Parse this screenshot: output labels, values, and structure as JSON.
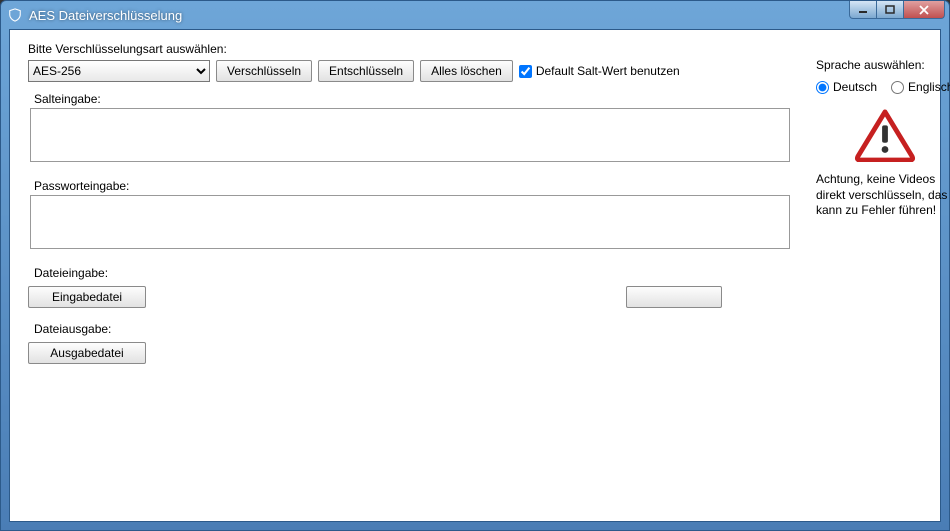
{
  "window": {
    "title": "AES Dateiverschlüsselung"
  },
  "main": {
    "select_label": "Bitte Verschlüsselungsart auswählen:",
    "algo_selected": "AES-256",
    "encrypt_btn": "Verschlüsseln",
    "decrypt_btn": "Entschlüsseln",
    "clear_btn": "Alles löschen",
    "default_salt_label": "Default Salt-Wert benutzen",
    "salt_label": "Salteingabe:",
    "salt_value": "",
    "password_label": "Passworteingabe:",
    "password_value": "",
    "file_in_label": "Dateieingabe:",
    "file_in_btn": "Eingabedatei",
    "file_out_label": "Dateiausgabe:",
    "file_out_btn": "Ausgabedatei"
  },
  "side": {
    "lang_label": "Sprache auswählen:",
    "lang_de": "Deutsch",
    "lang_en": "Englisch",
    "warning_text": "Achtung, keine Videos direkt verschlüsseln, das kann zu Fehler führen!"
  }
}
